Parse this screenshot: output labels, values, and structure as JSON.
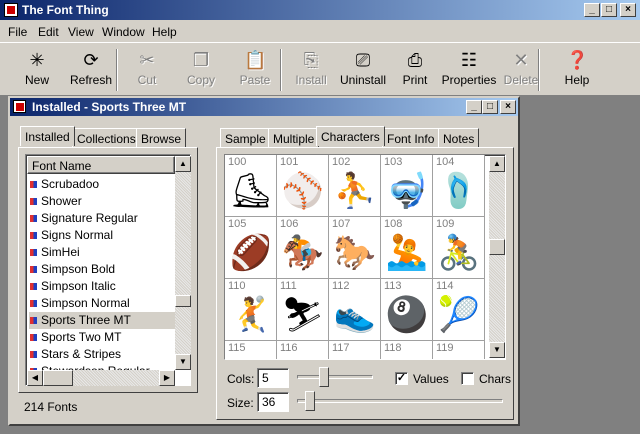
{
  "app": {
    "title": "The Font Thing",
    "min": "_",
    "max": "□",
    "close": "×"
  },
  "menu": [
    "File",
    "Edit",
    "View",
    "Window",
    "Help"
  ],
  "toolbar": {
    "buttons": [
      {
        "label": "New",
        "icon": "new-icon",
        "glyph": "✳",
        "enabled": true
      },
      {
        "label": "Refresh",
        "icon": "refresh-icon",
        "glyph": "⟳",
        "enabled": true
      },
      {
        "label": "Cut",
        "icon": "cut-icon",
        "glyph": "✂",
        "enabled": false
      },
      {
        "label": "Copy",
        "icon": "copy-icon",
        "glyph": "❐",
        "enabled": false
      },
      {
        "label": "Paste",
        "icon": "paste-icon",
        "glyph": "📋",
        "enabled": false
      },
      {
        "label": "Install",
        "icon": "install-icon",
        "glyph": "⎘",
        "enabled": false
      },
      {
        "label": "Uninstall",
        "icon": "uninstall-icon",
        "glyph": "⎚",
        "enabled": true
      },
      {
        "label": "Print",
        "icon": "print-icon",
        "glyph": "⎙",
        "enabled": true
      },
      {
        "label": "Properties",
        "icon": "properties-icon",
        "glyph": "☷",
        "enabled": true
      },
      {
        "label": "Delete",
        "icon": "delete-icon",
        "glyph": "✕",
        "enabled": false
      },
      {
        "label": "Help",
        "icon": "help-icon",
        "glyph": "❓",
        "enabled": true
      }
    ]
  },
  "child": {
    "title": "Installed - Sports Three MT"
  },
  "leftTabs": [
    "Installed",
    "Collections",
    "Browse"
  ],
  "fontList": {
    "header": "Font Name",
    "items": [
      "Scrubadoo",
      "Shower",
      "Signature Regular",
      "Signs Normal",
      "SimHei",
      "Simpson Bold",
      "Simpson Italic",
      "Simpson Normal",
      "Sports Three MT",
      "Sports Two MT",
      "Stars & Stripes",
      "Stewardson Regular"
    ],
    "selected": "Sports Three MT",
    "count": "214 Fonts"
  },
  "rightTabs": [
    "Sample",
    "Multiple",
    "Characters",
    "Font Info",
    "Notes"
  ],
  "activeRightTab": "Characters",
  "chars": {
    "cells": [
      {
        "n": "100",
        "g": "⛸"
      },
      {
        "n": "101",
        "g": "⚾"
      },
      {
        "n": "102",
        "g": "⛹"
      },
      {
        "n": "103",
        "g": "🤿"
      },
      {
        "n": "104",
        "g": "🩴"
      },
      {
        "n": "105",
        "g": "🏈"
      },
      {
        "n": "106",
        "g": "🏇"
      },
      {
        "n": "107",
        "g": "🐎"
      },
      {
        "n": "108",
        "g": "🤽"
      },
      {
        "n": "109",
        "g": "🚴"
      },
      {
        "n": "110",
        "g": "🤾"
      },
      {
        "n": "111",
        "g": "⛷"
      },
      {
        "n": "112",
        "g": "👟"
      },
      {
        "n": "113",
        "g": "🎱"
      },
      {
        "n": "114",
        "g": "🎾"
      },
      {
        "n": "115",
        "g": ""
      },
      {
        "n": "116",
        "g": ""
      },
      {
        "n": "117",
        "g": ""
      },
      {
        "n": "118",
        "g": ""
      },
      {
        "n": "119",
        "g": ""
      }
    ]
  },
  "controls": {
    "cols_label": "Cols:",
    "cols_value": "5",
    "size_label": "Size:",
    "size_value": "36",
    "values_label": "Values",
    "values_checked": "✓",
    "chars_label": "Chars",
    "chars_checked": ""
  }
}
